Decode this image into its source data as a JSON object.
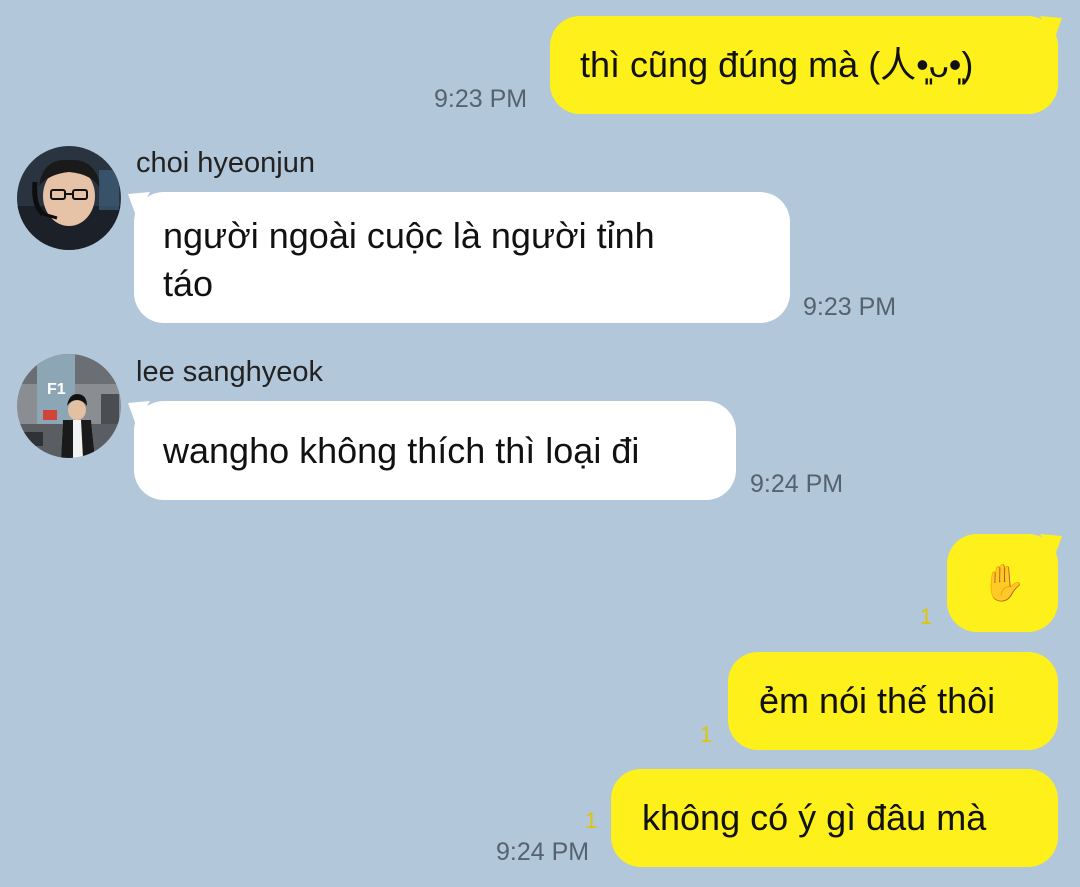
{
  "messages": [
    {
      "sender": "me",
      "text": "thì cũng đúng mà (人•͈ᴗ•͈)",
      "time": "9:23 PM"
    },
    {
      "sender": "choi hyeonjun",
      "line1": "người ngoài cuộc là người tỉnh",
      "line2": "táo",
      "time": "9:23 PM"
    },
    {
      "sender": "lee sanghyeok",
      "text": "wangho không thích thì loại đi",
      "time": "9:24 PM"
    },
    {
      "sender": "me",
      "text": "✋",
      "unread": "1"
    },
    {
      "sender": "me",
      "text": "ẻm nói thế thôi",
      "unread": "1"
    },
    {
      "sender": "me",
      "text": "không có ý gì đâu mà",
      "unread": "1",
      "time": "9:24 PM"
    }
  ],
  "avatar_badge": "F1",
  "colors": {
    "background": "#b2c7da",
    "my_bubble": "#fef01b",
    "their_bubble": "#ffffff",
    "unread": "#e0c400"
  }
}
